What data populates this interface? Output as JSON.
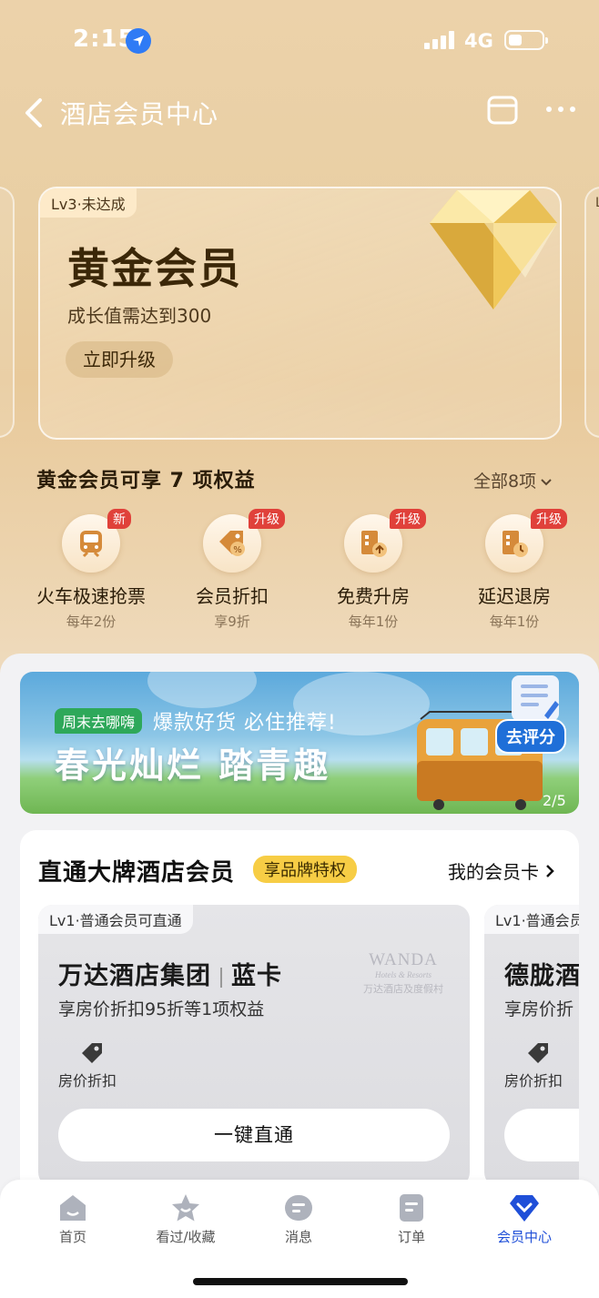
{
  "status_bar": {
    "time": "2:15",
    "network": "4G"
  },
  "nav": {
    "title": "酒店会员中心"
  },
  "member_card": {
    "level_tag": "Lv3·未达成",
    "name": "黄金会员",
    "growth_text": "成长值需达到300",
    "upgrade_button": "立即升级"
  },
  "side_card_right": {
    "level_tag": "L"
  },
  "benefits": {
    "title": "黄金会员可享 7 项权益",
    "all_label": "全部8项",
    "items": [
      {
        "badge": "新",
        "name": "火车极速抢票",
        "sub": "每年2份",
        "icon": "train-icon"
      },
      {
        "badge": "升级",
        "name": "会员折扣",
        "sub": "享9折",
        "icon": "discount-tag-icon"
      },
      {
        "badge": "升级",
        "name": "免费升房",
        "sub": "每年1份",
        "icon": "room-upgrade-icon"
      },
      {
        "badge": "升级",
        "name": "延迟退房",
        "sub": "每年1份",
        "icon": "late-checkout-icon"
      }
    ]
  },
  "banner": {
    "tag": "周末去哪嗨",
    "subtitle": "爆款好货 必住推荐!",
    "title": "春光灿烂 踏青趣",
    "rate_button": "去评分",
    "page": "2/5"
  },
  "brand_section": {
    "title": "直通大牌酒店会员",
    "badge": "享品牌特权",
    "my_cards": "我的会员卡",
    "cards": [
      {
        "level_tag": "Lv1·普通会员可直通",
        "hotel": "万达酒店集团",
        "tier": "蓝卡",
        "desc": "享房价折扣95折等1项权益",
        "benefit": "房价折扣",
        "button": "一键直通",
        "logo_main": "WANDA",
        "logo_sub": "Hotels & Resorts",
        "logo_cn": "万达酒店及度假村"
      },
      {
        "level_tag": "Lv1·普通会员",
        "hotel": "德胧酒",
        "desc": "享房价折",
        "benefit": "房价折扣",
        "button": ""
      }
    ]
  },
  "tab_bar": {
    "tabs": [
      {
        "label": "首页",
        "icon": "home-icon"
      },
      {
        "label": "看过/收藏",
        "icon": "star-icon"
      },
      {
        "label": "消息",
        "icon": "message-icon"
      },
      {
        "label": "订单",
        "icon": "order-icon"
      },
      {
        "label": "会员中心",
        "icon": "member-icon",
        "active": true
      }
    ]
  },
  "colors": {
    "accent": "#1f4fd8",
    "badge_red": "#e0413a",
    "brand_badge": "#f7cd45",
    "gold_bg": "#e8c99a"
  }
}
